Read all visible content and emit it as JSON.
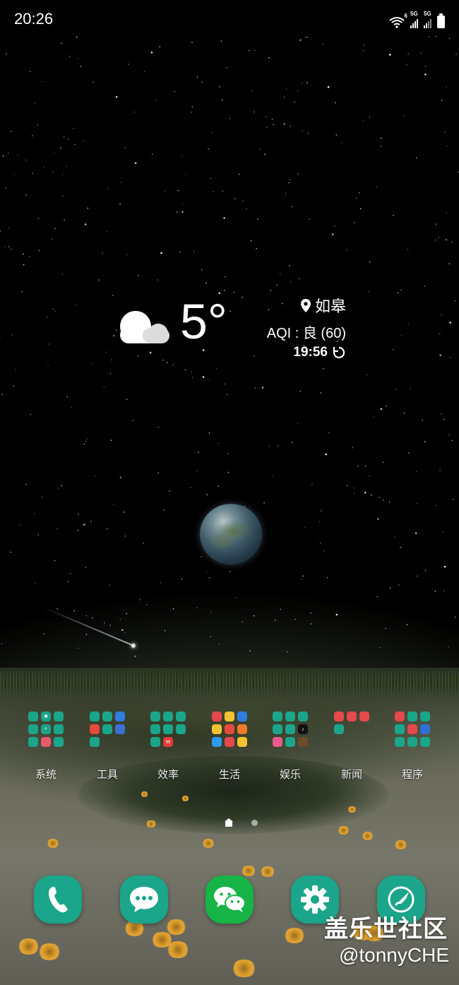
{
  "status_bar": {
    "time": "20:26",
    "wifi_label": "6",
    "sim1_label": "5G",
    "sim2_label": "5G"
  },
  "weather": {
    "temperature": "5°",
    "location": "如皋",
    "aqi": "AQI : 良 (60)",
    "updated_time": "19:56",
    "condition_icon": "cloud-icon"
  },
  "folders": [
    {
      "label": "系统"
    },
    {
      "label": "工具"
    },
    {
      "label": "效率"
    },
    {
      "label": "生活"
    },
    {
      "label": "娱乐"
    },
    {
      "label": "新闻"
    },
    {
      "label": "程序"
    }
  ],
  "dock": [
    {
      "icon": "phone-icon"
    },
    {
      "icon": "messages-icon"
    },
    {
      "icon": "wechat-icon"
    },
    {
      "icon": "settings-icon"
    },
    {
      "icon": "galaxy-store-icon"
    }
  ],
  "watermark": {
    "site": "盖乐世社区",
    "author": "@tonnyCHE"
  },
  "colors": {
    "accent": "#1ba58a",
    "wechat": "#16b346"
  }
}
